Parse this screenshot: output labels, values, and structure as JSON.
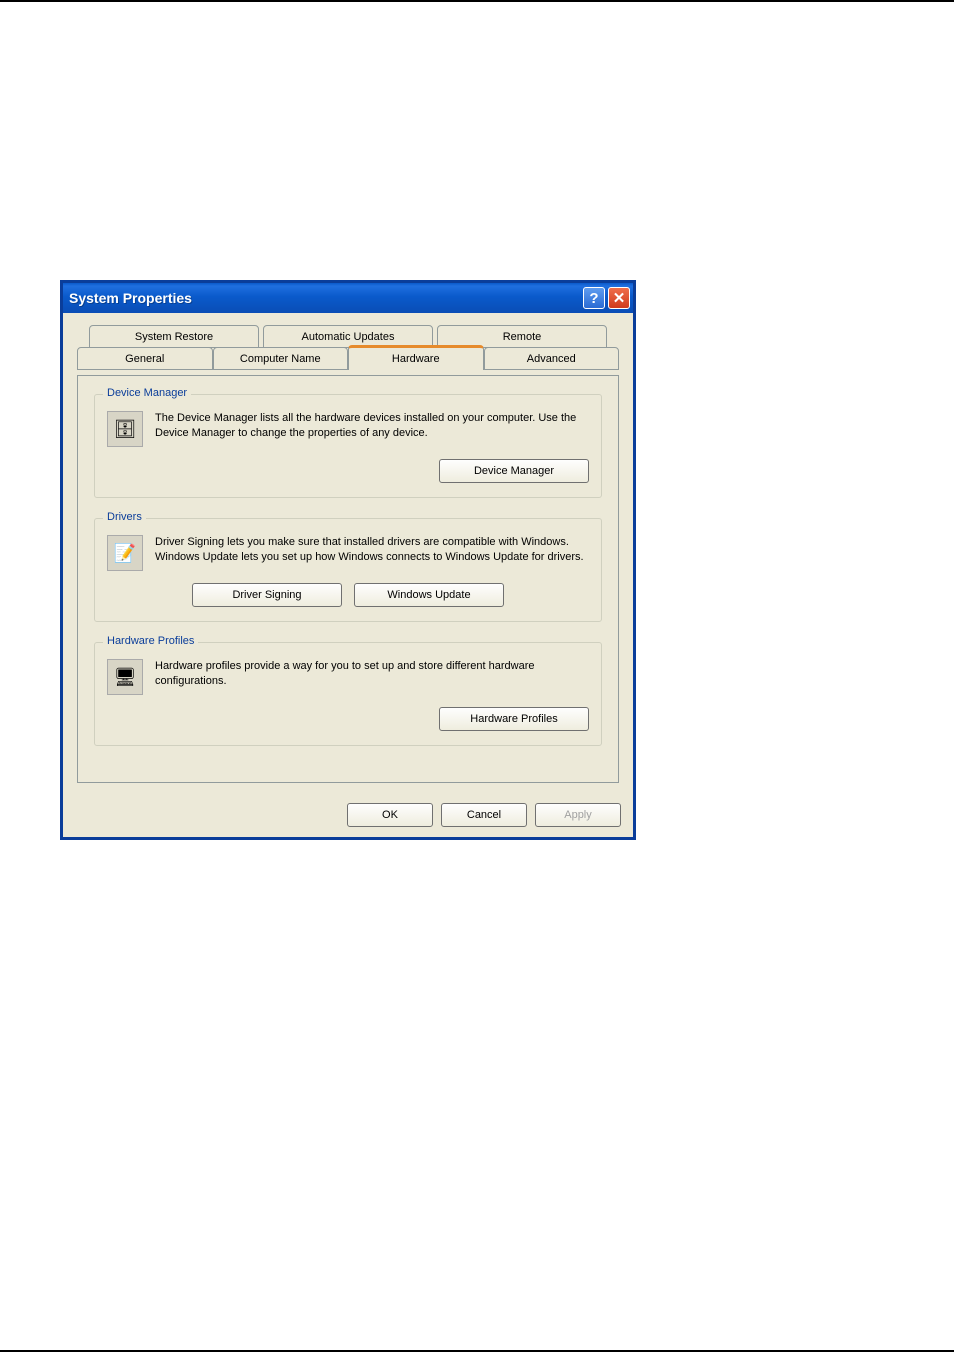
{
  "dialog": {
    "title": "System Properties",
    "tabs_back": [
      "System Restore",
      "Automatic Updates",
      "Remote"
    ],
    "tabs_front": [
      "General",
      "Computer Name",
      "Hardware",
      "Advanced"
    ],
    "active_tab": "Hardware"
  },
  "groups": {
    "device_manager": {
      "legend": "Device Manager",
      "text": "The Device Manager lists all the hardware devices installed on your computer. Use the Device Manager to change the properties of any device.",
      "button": "Device Manager",
      "icon": "🗄"
    },
    "drivers": {
      "legend": "Drivers",
      "text": "Driver Signing lets you make sure that installed drivers are compatible with Windows. Windows Update lets you set up how Windows connects to Windows Update for drivers.",
      "button1": "Driver Signing",
      "button2": "Windows Update",
      "icon": "📝"
    },
    "hardware_profiles": {
      "legend": "Hardware Profiles",
      "text": "Hardware profiles provide a way for you to set up and store different hardware configurations.",
      "button": "Hardware Profiles",
      "icon": "🖥"
    }
  },
  "buttons": {
    "ok": "OK",
    "cancel": "Cancel",
    "apply": "Apply"
  }
}
